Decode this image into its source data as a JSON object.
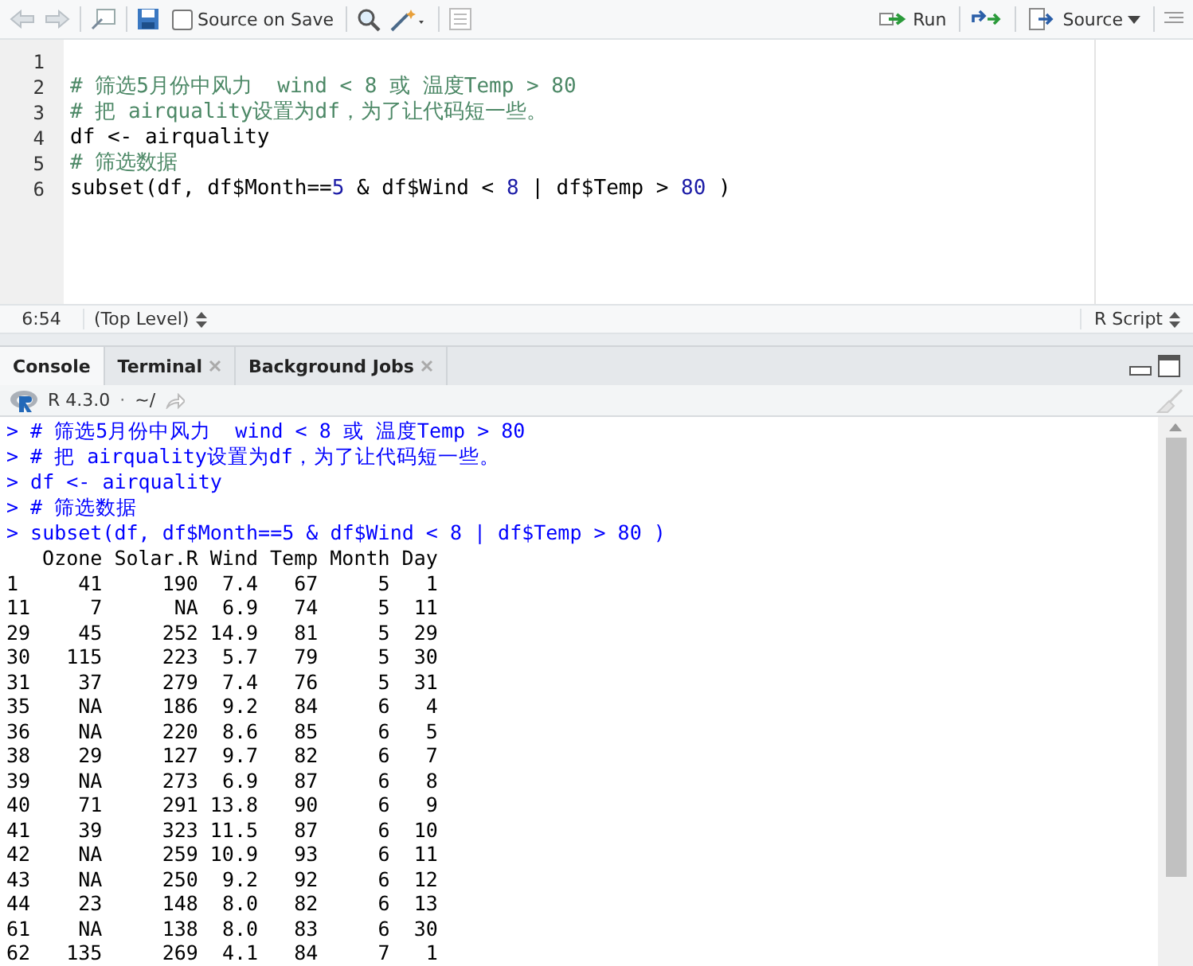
{
  "editor_toolbar": {
    "source_on_save": {
      "label": "Source on Save",
      "checked": false
    },
    "run": "Run",
    "source": "Source"
  },
  "editor": {
    "lines": [
      {
        "number": "1"
      },
      {
        "number": "2",
        "tokens": [
          {
            "text": "# 筛选5月份中风力  wind < 8 或 温度Temp > 80",
            "kind": "comment"
          }
        ]
      },
      {
        "number": "3",
        "tokens": [
          {
            "text": "# 把 airquality设置为df，为了让代码短一些。",
            "kind": "comment"
          }
        ]
      },
      {
        "number": "4",
        "tokens": [
          {
            "text": "df <- airquality",
            "kind": "plain"
          }
        ]
      },
      {
        "number": "5",
        "tokens": [
          {
            "text": "# 筛选数据",
            "kind": "comment"
          }
        ]
      },
      {
        "number": "6",
        "tokens": [
          {
            "text": "subset(df, df$Month==",
            "kind": "plain"
          },
          {
            "text": "5",
            "kind": "number"
          },
          {
            "text": " & df$Wind < ",
            "kind": "plain"
          },
          {
            "text": "8",
            "kind": "number"
          },
          {
            "text": " | df$Temp > ",
            "kind": "plain"
          },
          {
            "text": "80",
            "kind": "number"
          },
          {
            "text": " )",
            "kind": "plain"
          }
        ]
      }
    ]
  },
  "editor_status": {
    "position": "6:54",
    "scope": "(Top Level)",
    "file_type": "R Script"
  },
  "console_tabs": [
    {
      "label": "Console",
      "selected": true,
      "closable": false
    },
    {
      "label": "Terminal",
      "selected": false,
      "closable": true
    },
    {
      "label": "Background Jobs",
      "selected": false,
      "closable": true
    }
  ],
  "console_header": {
    "version": "R 4.3.0",
    "separator": "·",
    "path": "~/"
  },
  "console": {
    "input_lines": [
      "> # 筛选5月份中风力  wind < 8 或 温度Temp > 80",
      "> # 把 airquality设置为df，为了让代码短一些。",
      "> df <- airquality",
      "> # 筛选数据",
      "> subset(df, df$Month==5 & df$Wind < 8 | df$Temp > 80 )"
    ],
    "table": {
      "columns": [
        "Ozone",
        "Solar.R",
        "Wind",
        "Temp",
        "Month",
        "Day"
      ],
      "rows": [
        {
          "name": "1",
          "cells": [
            "41",
            "190",
            "7.4",
            "67",
            "5",
            "1"
          ]
        },
        {
          "name": "11",
          "cells": [
            "7",
            "NA",
            "6.9",
            "74",
            "5",
            "11"
          ]
        },
        {
          "name": "29",
          "cells": [
            "45",
            "252",
            "14.9",
            "81",
            "5",
            "29"
          ]
        },
        {
          "name": "30",
          "cells": [
            "115",
            "223",
            "5.7",
            "79",
            "5",
            "30"
          ]
        },
        {
          "name": "31",
          "cells": [
            "37",
            "279",
            "7.4",
            "76",
            "5",
            "31"
          ]
        },
        {
          "name": "35",
          "cells": [
            "NA",
            "186",
            "9.2",
            "84",
            "6",
            "4"
          ]
        },
        {
          "name": "36",
          "cells": [
            "NA",
            "220",
            "8.6",
            "85",
            "6",
            "5"
          ]
        },
        {
          "name": "38",
          "cells": [
            "29",
            "127",
            "9.7",
            "82",
            "6",
            "7"
          ]
        },
        {
          "name": "39",
          "cells": [
            "NA",
            "273",
            "6.9",
            "87",
            "6",
            "8"
          ]
        },
        {
          "name": "40",
          "cells": [
            "71",
            "291",
            "13.8",
            "90",
            "6",
            "9"
          ]
        },
        {
          "name": "41",
          "cells": [
            "39",
            "323",
            "11.5",
            "87",
            "6",
            "10"
          ]
        },
        {
          "name": "42",
          "cells": [
            "NA",
            "259",
            "10.9",
            "93",
            "6",
            "11"
          ]
        },
        {
          "name": "43",
          "cells": [
            "NA",
            "250",
            "9.2",
            "92",
            "6",
            "12"
          ]
        },
        {
          "name": "44",
          "cells": [
            "23",
            "148",
            "8.0",
            "82",
            "6",
            "13"
          ]
        },
        {
          "name": "61",
          "cells": [
            "NA",
            "138",
            "8.0",
            "83",
            "6",
            "30"
          ]
        },
        {
          "name": "62",
          "cells": [
            "135",
            "269",
            "4.1",
            "84",
            "7",
            "1"
          ]
        }
      ]
    }
  }
}
